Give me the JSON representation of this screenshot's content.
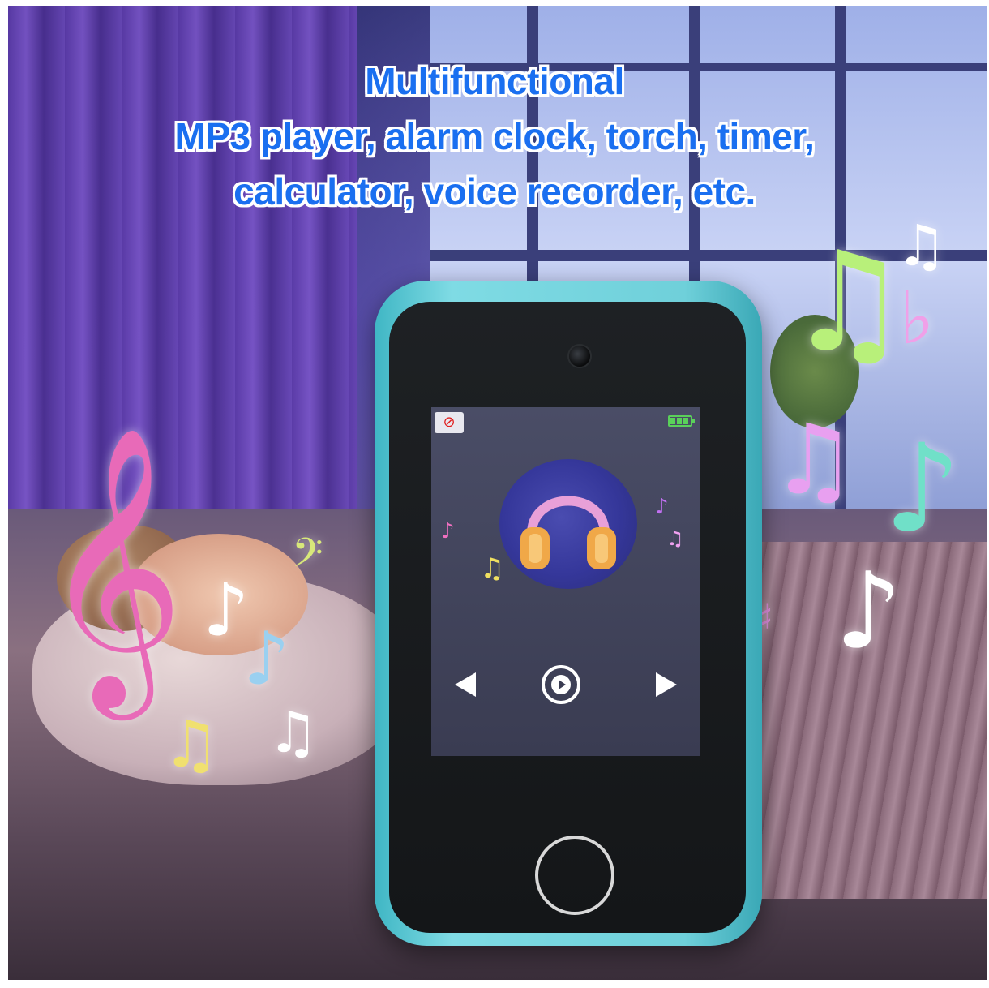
{
  "headline": {
    "line1": "Multifunctional",
    "line2": "MP3 player, alarm clock, torch, timer,",
    "line3": "calculator, voice recorder, etc."
  },
  "colors": {
    "headline_text": "#1a6ff0",
    "headline_outline": "#ffffff",
    "device_shell": "#6fd0da",
    "device_face": "#1e2124",
    "battery": "#5ad05a"
  },
  "device": {
    "status_icon": "mute-icon",
    "battery_icon": "battery-full-icon",
    "album_art": "headphones-icon",
    "controls": [
      "previous-icon",
      "play-icon",
      "next-icon"
    ],
    "home_button": "home-button"
  }
}
